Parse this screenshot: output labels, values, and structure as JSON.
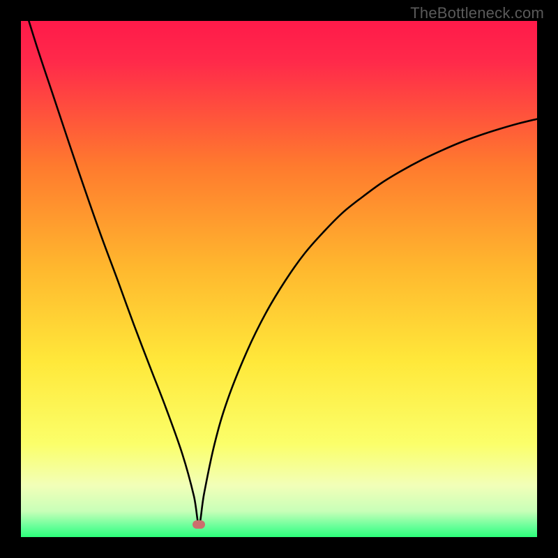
{
  "watermark": "TheBottleneck.com",
  "chart_data": {
    "type": "line",
    "title": "",
    "xlabel": "",
    "ylabel": "",
    "xlim": [
      0,
      100
    ],
    "ylim": [
      0,
      100
    ],
    "background_gradient": {
      "top": "#ff1a4a",
      "mid_upper": "#ff9e2a",
      "mid": "#ffe83a",
      "mid_lower": "#f6ffb0",
      "bottom": "#2cff7a"
    },
    "optimum_x": 34.5,
    "optimum_y": 2.5,
    "marker": {
      "x_pct": 34.5,
      "y_pct": 2.5,
      "color": "#cc6f6d"
    },
    "series": [
      {
        "name": "bottleneck-curve",
        "color": "#000000",
        "x": [
          0.0,
          3.1,
          6.3,
          9.4,
          12.5,
          15.6,
          18.8,
          21.9,
          25.0,
          28.1,
          31.3,
          33.5,
          34.5,
          35.5,
          37.5,
          40.0,
          43.8,
          47.5,
          51.3,
          55.0,
          58.8,
          62.5,
          66.3,
          70.0,
          73.8,
          77.5,
          81.3,
          85.0,
          88.8,
          92.5,
          96.3,
          100.0
        ],
        "y": [
          105.0,
          95.0,
          85.4,
          76.1,
          67.0,
          58.2,
          49.6,
          41.1,
          33.0,
          25.0,
          16.0,
          8.0,
          2.5,
          8.5,
          18.0,
          26.5,
          36.0,
          43.5,
          49.8,
          55.0,
          59.3,
          63.0,
          66.0,
          68.7,
          71.0,
          73.0,
          74.8,
          76.4,
          77.8,
          79.0,
          80.1,
          81.0
        ]
      }
    ]
  }
}
